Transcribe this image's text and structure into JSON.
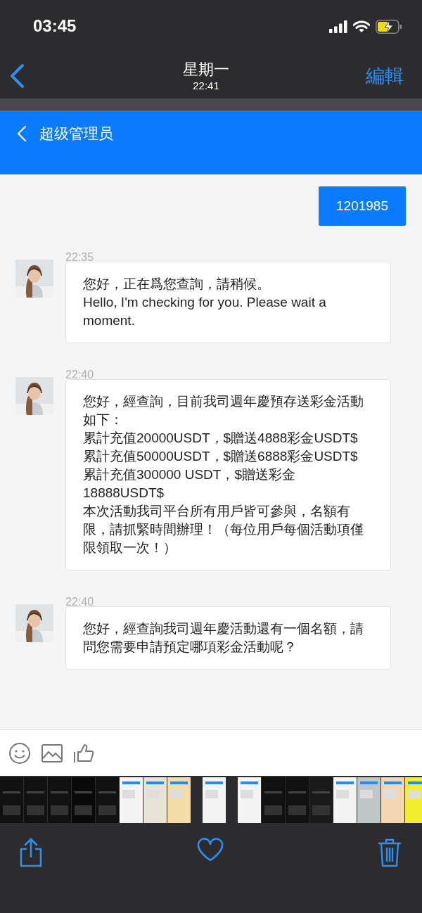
{
  "status_bar": {
    "time": "03:45"
  },
  "nav_bar": {
    "title": "星期一",
    "subtitle": "22:41",
    "edit": "編輯"
  },
  "chat_header": {
    "title": "超级管理员"
  },
  "messages": [
    {
      "kind": "sent",
      "lines": [
        "1201985"
      ]
    },
    {
      "kind": "received",
      "time": "22:35",
      "lines": [
        "您好，正在爲您查詢，請稍候。",
        "Hello, I'm checking for you. Please wait a moment."
      ]
    },
    {
      "kind": "received",
      "time": "22:40",
      "lines": [
        "您好，經查詢，目前我司週年慶預存送彩金活動如下：",
        "累計充值20000USDT，$贈送4888彩金USDT$",
        "累計充值50000USDT，$贈送6888彩金USDT$",
        "累計充值300000 USDT，$贈送彩金18888USDT$",
        "本次活動我司平台所有用戶皆可參與，名額有限，請抓緊時間辦理！（每位用戶每個活動項僅限領取一次！）"
      ]
    },
    {
      "kind": "received",
      "time": "22:40",
      "lines": [
        "您好，經查詢我司週年慶活動還有一個名額，請問您需要申請預定哪項彩金活動呢？"
      ]
    }
  ]
}
